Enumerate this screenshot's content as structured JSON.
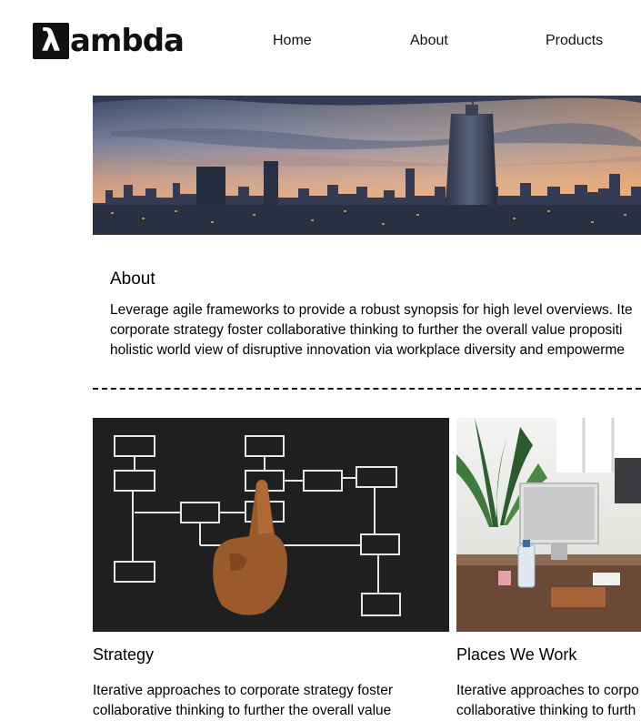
{
  "header": {
    "logo_mark": "λ",
    "logo_text": "ambda",
    "nav": [
      {
        "label": "Home"
      },
      {
        "label": "About"
      },
      {
        "label": "Products"
      }
    ]
  },
  "hero": {
    "image": "city-skyline-sunset-photo"
  },
  "about": {
    "heading": "About",
    "lines": [
      "Leverage agile frameworks to provide a robust synopsis for high level overviews. Ite",
      "corporate strategy foster collaborative thinking to further the overall value propositi",
      "holistic world view of disruptive innovation via workplace diversity and empowerme"
    ]
  },
  "cards": [
    {
      "image": "flowchart-chalkboard-hand-photo",
      "title": "Strategy",
      "lines": [
        "Iterative approaches to corporate strategy foster",
        "collaborative thinking to further the overall value"
      ]
    },
    {
      "image": "office-workspace-desk-photo",
      "title": "Places We Work",
      "lines": [
        "Iterative approaches to corpo",
        "collaborative thinking to furth"
      ]
    }
  ]
}
